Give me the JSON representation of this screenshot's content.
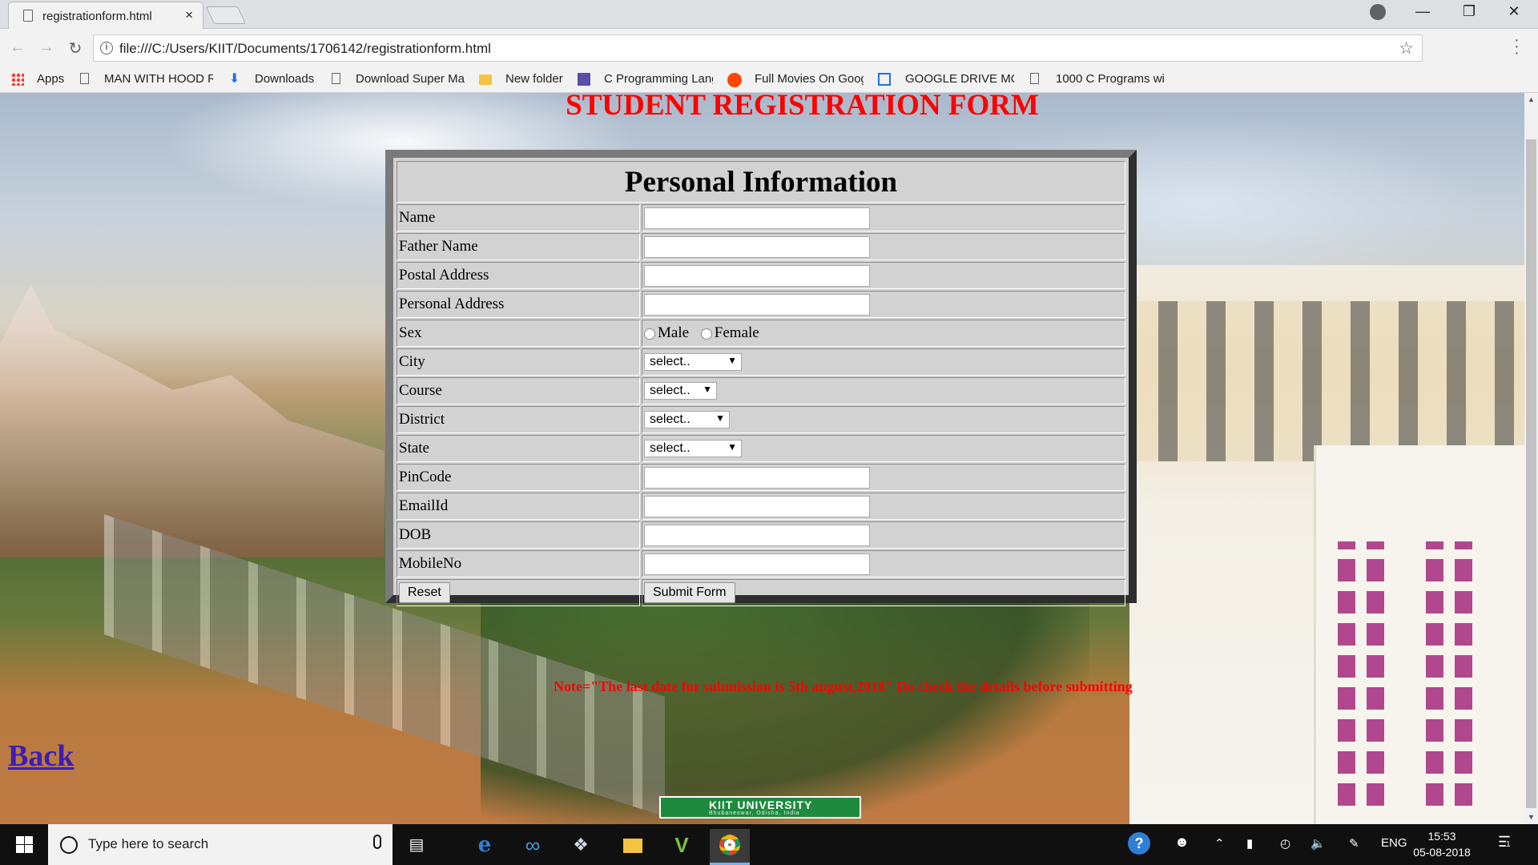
{
  "browser": {
    "tab_title": "registrationform.html",
    "tab_close": "×",
    "url": "file:///C:/Users/KIIT/Documents/1706142/registrationform.html",
    "bookmarks": [
      {
        "label": "Apps",
        "icon": "apps-grid-icon"
      },
      {
        "label": "MAN WITH HOOD R",
        "icon": "page-icon"
      },
      {
        "label": "Downloads",
        "icon": "download-icon"
      },
      {
        "label": "Download Super Ma",
        "icon": "page-icon"
      },
      {
        "label": "New folder",
        "icon": "folder-icon"
      },
      {
        "label": "C Programming Lang",
        "icon": "c-programming-icon"
      },
      {
        "label": "Full Movies On Goog",
        "icon": "reddit-icon"
      },
      {
        "label": "GOOGLE DRIVE MOV",
        "icon": "drive-window-icon"
      },
      {
        "label": "1000 C Programs wit",
        "icon": "page-icon"
      }
    ]
  },
  "page": {
    "heading": "STUDENT REGISTRATION FORM",
    "form": {
      "section_title": "Personal Information",
      "fields": [
        {
          "label": "Name",
          "type": "text"
        },
        {
          "label": "Father Name",
          "type": "text"
        },
        {
          "label": "Postal Address",
          "type": "text"
        },
        {
          "label": "Personal Address",
          "type": "text"
        },
        {
          "label": "Sex",
          "type": "radio",
          "options": [
            "Male",
            "Female"
          ]
        },
        {
          "label": "City",
          "type": "select",
          "selected": "select.."
        },
        {
          "label": "Course",
          "type": "select",
          "selected": "select.."
        },
        {
          "label": "District",
          "type": "select",
          "selected": "select.."
        },
        {
          "label": "State",
          "type": "select",
          "selected": "select.."
        },
        {
          "label": "PinCode",
          "type": "text"
        },
        {
          "label": "EmailId",
          "type": "text"
        },
        {
          "label": "DOB",
          "type": "text"
        },
        {
          "label": "MobileNo",
          "type": "text"
        }
      ],
      "reset_label": "Reset",
      "submit_label": "Submit Form"
    },
    "note": "Note=\"The last date for submission is 5th august,2018\" Do check the details before submitting",
    "back_link": "Back",
    "logo_text": "KIIT UNIVERSITY",
    "logo_subtext": "Bhubaneswar, Odisha, India"
  },
  "taskbar": {
    "search_placeholder": "Type here to search",
    "language": "ENG",
    "time": "15:53",
    "date": "05-08-2018",
    "notification_count": "1"
  }
}
